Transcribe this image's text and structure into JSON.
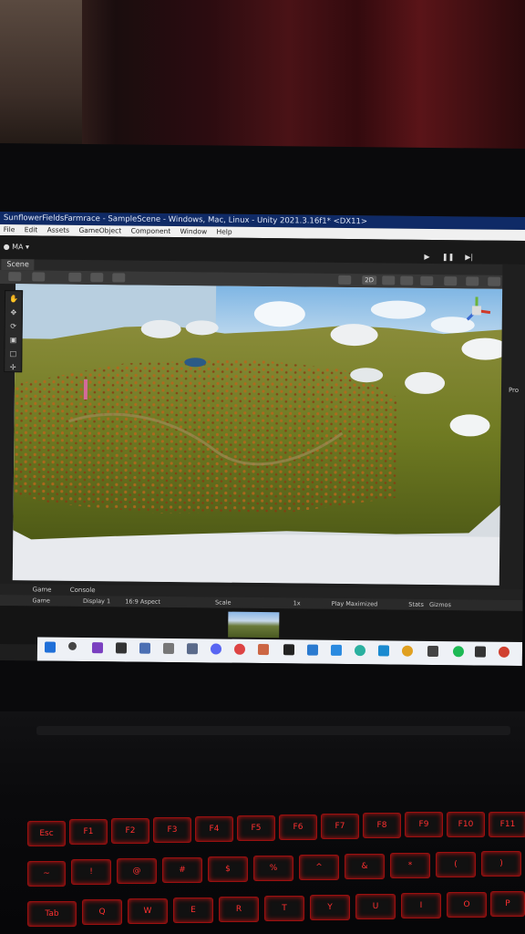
{
  "window": {
    "title": "SunflowerFieldsFarmrace - SampleScene - Windows, Mac, Linux - Unity 2021.3.16f1* <DX11>"
  },
  "menu": [
    "File",
    "Edit",
    "Assets",
    "GameObject",
    "Component",
    "Window",
    "Help"
  ],
  "toolbar": {
    "account": "MA"
  },
  "scene": {
    "tab_label": "Scene",
    "mode_2d": "2D"
  },
  "project_panel": {
    "label": "Pro"
  },
  "bottom_tabs": {
    "game": "Game",
    "console": "Console"
  },
  "game_bar": {
    "mode": "Game",
    "display": "Display 1",
    "aspect": "16:9 Aspect",
    "scale_label": "Scale",
    "scale_value": "1x",
    "play_mode": "Play Maximized",
    "stats": "Stats",
    "gizmos": "Gizmos"
  },
  "keyboard": {
    "fn_row": [
      "Esc",
      "F1",
      "F2",
      "F3",
      "F4",
      "F5",
      "F6",
      "F7",
      "F8",
      "F9",
      "F10",
      "F11"
    ],
    "num_row": [
      "~",
      "!",
      "@",
      "#",
      "$",
      "%",
      "^",
      "&",
      "*",
      "(",
      ")"
    ],
    "letter_row": [
      "Tab",
      "Q",
      "W",
      "E",
      "R",
      "T",
      "Y",
      "U",
      "I",
      "O",
      "P"
    ]
  },
  "colors": {
    "title_bar": "#0f2a66",
    "editor_bg": "#1e1e1e",
    "key_glow": "#ff3030"
  }
}
